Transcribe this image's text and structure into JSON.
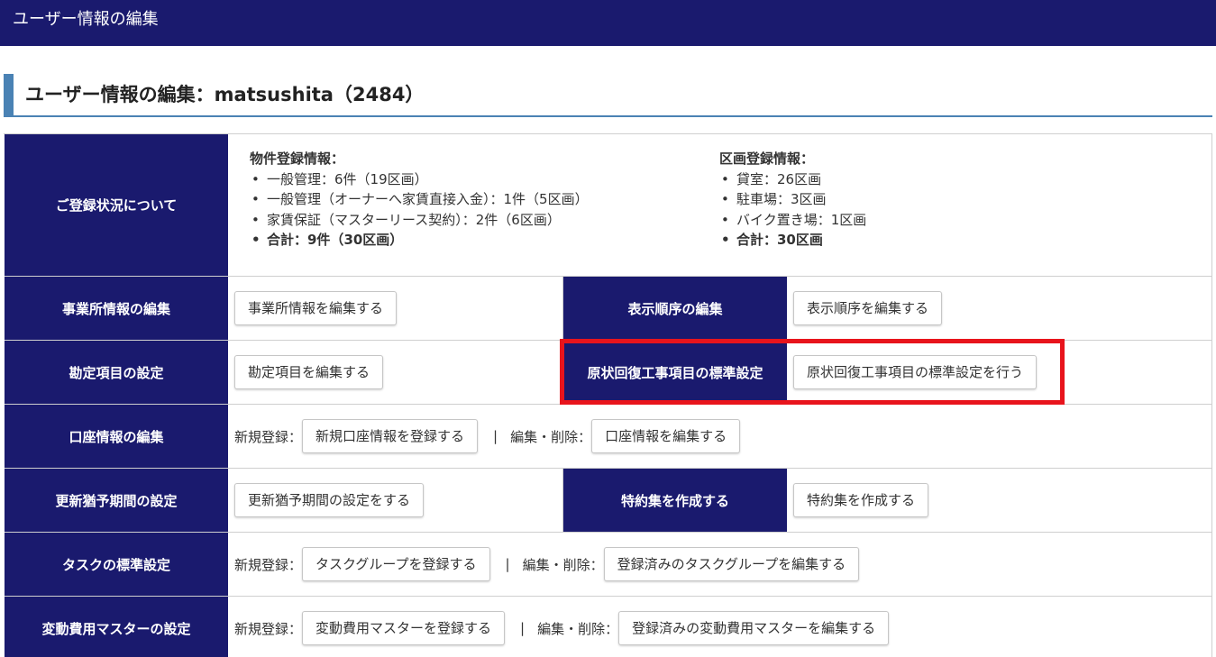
{
  "header": {
    "title": "ユーザー情報の編集"
  },
  "page": {
    "heading": "ユーザー情報の編集：matsushita（2484）"
  },
  "registration": {
    "label": "ご登録状況について",
    "property": {
      "title": "物件登録情報：",
      "items": [
        "一般管理：6件（19区画）",
        "一般管理（オーナーへ家賃直接入金）：1件（5区画）",
        "家賃保証（マスターリース契約）：2件（6区画）"
      ],
      "total": "合計：9件（30区画）"
    },
    "section": {
      "title": "区画登録情報：",
      "items": [
        "貸室：26区画",
        "駐車場：3区画",
        "バイク置き場：1区画"
      ],
      "total": "合計：30区画"
    }
  },
  "rows": {
    "office": {
      "label": "事業所情報の編集",
      "button": "事業所情報を編集する"
    },
    "display_order": {
      "label": "表示順序の編集",
      "button": "表示順序を編集する"
    },
    "account_items": {
      "label": "勘定項目の設定",
      "button": "勘定項目を編集する"
    },
    "restoration": {
      "label": "原状回復工事項目の標準設定",
      "button": "原状回復工事項目の標準設定を行う"
    },
    "bank": {
      "label": "口座情報の編集",
      "new_label": "新規登録：",
      "new_button": "新規口座情報を登録する",
      "separator": "|",
      "edit_label": "編集・削除：",
      "edit_button": "口座情報を編集する"
    },
    "grace": {
      "label": "更新猶予期間の設定",
      "button": "更新猶予期間の設定をする"
    },
    "special": {
      "label": "特約集を作成する",
      "button": "特約集を作成する"
    },
    "task": {
      "label": "タスクの標準設定",
      "new_label": "新規登録：",
      "new_button": "タスクグループを登録する",
      "separator": "|",
      "edit_label": "編集・削除：",
      "edit_button": "登録済みのタスクグループを編集する"
    },
    "variable_cost": {
      "label": "変動費用マスターの設定",
      "new_label": "新規登録：",
      "new_button": "変動費用マスターを登録する",
      "separator": "|",
      "edit_label": "編集・削除：",
      "edit_button": "登録済みの変動費用マスターを編集する"
    }
  },
  "colors": {
    "header_bg": "#1a1a6e",
    "heading_accent": "#4a82b4",
    "highlight": "#e8141c"
  }
}
